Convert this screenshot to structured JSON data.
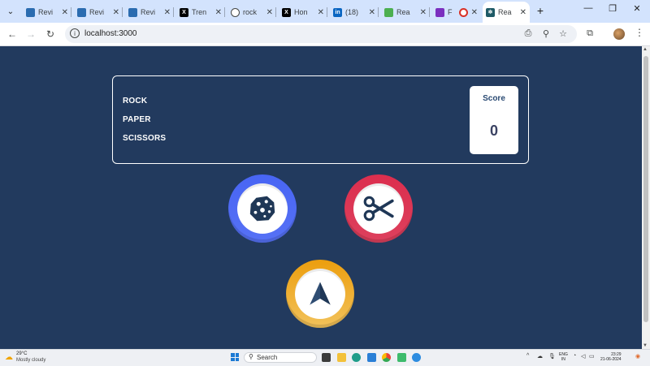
{
  "browser": {
    "tabs": [
      {
        "label": "Revi",
        "favicon": "revi-icon",
        "color": "#2b6cb0"
      },
      {
        "label": "Revi",
        "favicon": "revi-icon",
        "color": "#2b6cb0"
      },
      {
        "label": "Revi",
        "favicon": "revi-icon",
        "color": "#2b6cb0"
      },
      {
        "label": "Tren",
        "favicon": "x-icon",
        "color": "#000000"
      },
      {
        "label": "rock",
        "favicon": "globe-icon",
        "color": "#444746"
      },
      {
        "label": "Hon",
        "favicon": "x-icon",
        "color": "#000000"
      },
      {
        "label": "(18)",
        "favicon": "linkedin-icon",
        "color": "#0a66c2"
      },
      {
        "label": "Rea",
        "favicon": "recycle-icon",
        "color": "#4caf50"
      },
      {
        "label": "F",
        "favicon": "app-icon",
        "color": "#7b2fbf"
      },
      {
        "label": "Rea",
        "favicon": "react-icon",
        "color": "#1e5a66"
      }
    ],
    "active_tab": 9,
    "url": "localhost:3000"
  },
  "game": {
    "title_words": [
      "ROCK",
      "PAPER",
      "SCISSORS"
    ],
    "score_label": "Score",
    "score_value": "0",
    "choices": [
      {
        "name": "rock",
        "icon": "rock-icon",
        "ring_colors": [
          "#4865f4",
          "#5671f5"
        ]
      },
      {
        "name": "scissors",
        "icon": "scissors-icon",
        "ring_colors": [
          "#dc2e4e",
          "#dd405d"
        ]
      },
      {
        "name": "paper",
        "icon": "paper-plane-icon",
        "ring_colors": [
          "#ec9e0e",
          "#f2c25b"
        ]
      }
    ],
    "colors": {
      "background": "#223a5e",
      "icon_fill": "#1f3756"
    }
  },
  "taskbar": {
    "weather_temp": "29°C",
    "weather_desc": "Mostly cloudy",
    "search_label": "Search",
    "lang_top": "ENG",
    "lang_bottom": "IN",
    "time": "23:29",
    "date": "21-06-2024"
  }
}
